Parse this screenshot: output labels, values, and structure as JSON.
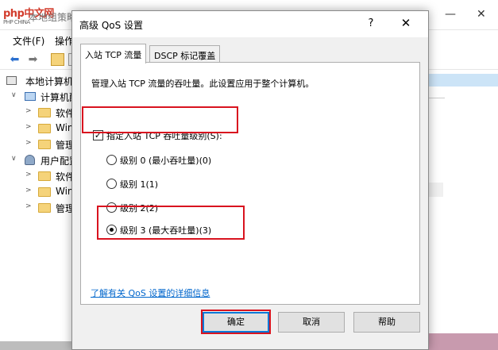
{
  "background_window": {
    "logo_text": "php中文网",
    "logo_sub": "PHP CHINA",
    "title": "本地组策略",
    "menu": [
      "文件(F)",
      "操作"
    ],
    "tree": [
      {
        "label": "本地计算机",
        "icon": "computer-icon",
        "level": 0,
        "expander": ""
      },
      {
        "label": "计算机配",
        "icon": "computer-config-icon",
        "level": 1,
        "expander": "∨"
      },
      {
        "label": "软件",
        "icon": "folder-icon",
        "level": 2,
        "expander": ">"
      },
      {
        "label": "Win",
        "icon": "folder-icon",
        "level": 2,
        "expander": ">"
      },
      {
        "label": "管理",
        "icon": "folder-icon",
        "level": 2,
        "expander": ">"
      },
      {
        "label": "用户配置",
        "icon": "user-config-icon",
        "level": 1,
        "expander": "∨"
      },
      {
        "label": "软件",
        "icon": "folder-icon",
        "level": 2,
        "expander": ">"
      },
      {
        "label": "Win",
        "icon": "folder-icon",
        "level": 2,
        "expander": ">"
      },
      {
        "label": "管理",
        "icon": "folder-icon",
        "level": 2,
        "expander": ">"
      }
    ]
  },
  "dialog": {
    "title": "高级 QoS 设置",
    "help_glyph": "?",
    "close_glyph": "✕",
    "tabs": [
      {
        "label": "入站 TCP 流量",
        "active": true
      },
      {
        "label": "DSCP 标记覆盖",
        "active": false
      }
    ],
    "description": "管理入站 TCP 流量的吞吐量。此设置应用于整个计算机。",
    "checkbox": {
      "label": "指定入站 TCP 吞吐量级别(S):",
      "checked": true,
      "check_glyph": "✓"
    },
    "radio_options": [
      {
        "label": "级别 0 (最小吞吐量)(0)",
        "selected": false
      },
      {
        "label": "级别 1(1)",
        "selected": false
      },
      {
        "label": "级别 2(2)",
        "selected": false
      },
      {
        "label": "级别 3 (最大吞吐量)(3)",
        "selected": true
      }
    ],
    "more_info_link": "了解有关 QoS 设置的详细信息",
    "buttons": {
      "ok": "确定",
      "cancel": "取消",
      "help": "帮助"
    }
  },
  "colors": {
    "highlight_box": "#d9131f",
    "link": "#0066cc",
    "default_button_border": "#0078d7"
  }
}
